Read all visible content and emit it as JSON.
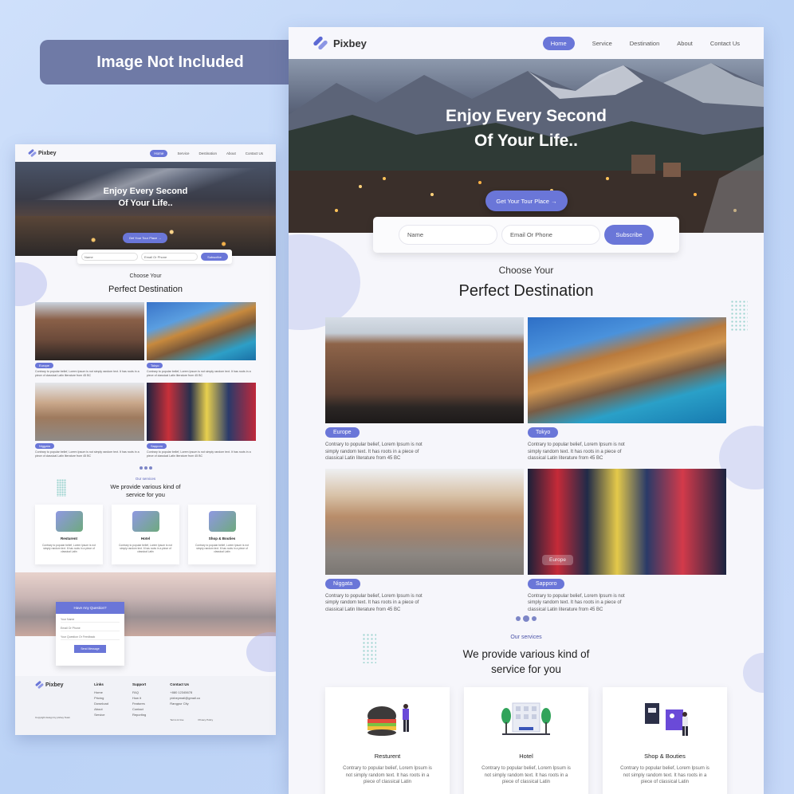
{
  "badge": {
    "label": "Image Not Included"
  },
  "brand": {
    "name": "Pixbey",
    "accent": "#6a76d8"
  },
  "nav": {
    "items": [
      {
        "label": "Home",
        "active": true
      },
      {
        "label": "Service",
        "active": false
      },
      {
        "label": "Destination",
        "active": false
      },
      {
        "label": "About",
        "active": false
      },
      {
        "label": "Contact Us",
        "active": false
      }
    ]
  },
  "hero": {
    "line1": "Enjoy Every Second",
    "line2": "Of Your Life..",
    "cta": "Get Your Tour Place →"
  },
  "subscribe": {
    "name_placeholder": "Name",
    "contact_placeholder": "Email Or Phone",
    "button": "Subscribe"
  },
  "destinations": {
    "kicker": "Choose Your",
    "title": "Perfect Destination",
    "cards": [
      {
        "tag": "Europe",
        "text": "Contrary to popular belief, Lorem Ipsum is not simply random text. It has roots in a piece of classical Latin literature from 45 BC"
      },
      {
        "tag": "Tokyo",
        "text": "Contrary to popular belief, Lorem Ipsum is not simply random text. It has roots in a piece of classical Latin literature from 45 BC"
      },
      {
        "tag": "Niggata",
        "text": "Contrary to popular belief, Lorem Ipsum is not simply random text. It has roots in a piece of classical Latin literature from 45 BC"
      },
      {
        "tag": "Sapporo",
        "text": "Contrary to popular belief, Lorem Ipsum is not simply random text. It has roots in a piece of classical Latin literature from 45 BC"
      }
    ],
    "overlay_label": "Europe"
  },
  "services": {
    "kicker": "Our services",
    "title_line1": "We provide various kind of",
    "title_line2": "service for you",
    "cards": [
      {
        "title": "Resturent",
        "text": "Contrary to popular belief, Lorem Ipsum is not simply random text. It has roots in a piece of classical Latin"
      },
      {
        "title": "Hotel",
        "text": "Contrary to popular belief, Lorem Ipsum is not simply random text. It has roots in a piece of classical Latin"
      },
      {
        "title": "Shop & Bouties",
        "text": "Contrary to popular belief, Lorem Ipsum is not simply random text. It has roots in a piece of classical Latin"
      }
    ]
  },
  "contact_form": {
    "title": "Have Any Question?",
    "fields": [
      "Your Name",
      "Email Or Phone",
      "Your Question Or Feedback"
    ],
    "button": "Send Message"
  },
  "footer": {
    "links_title": "Links",
    "links": [
      "Home",
      "Pricing",
      "Download",
      "About",
      "Service"
    ],
    "support_title": "Support",
    "support": [
      "FAQ",
      "How it",
      "Features",
      "Contact",
      "Reporting"
    ],
    "contact_title": "Contact Us",
    "contact": [
      "+880 12345678",
      "pixbeymail@gmail.co",
      "Rangpur City"
    ],
    "copyright": "Copyright design by pixbey Team",
    "terms": "Terms & Use",
    "privacy": "Privacy Policy"
  }
}
